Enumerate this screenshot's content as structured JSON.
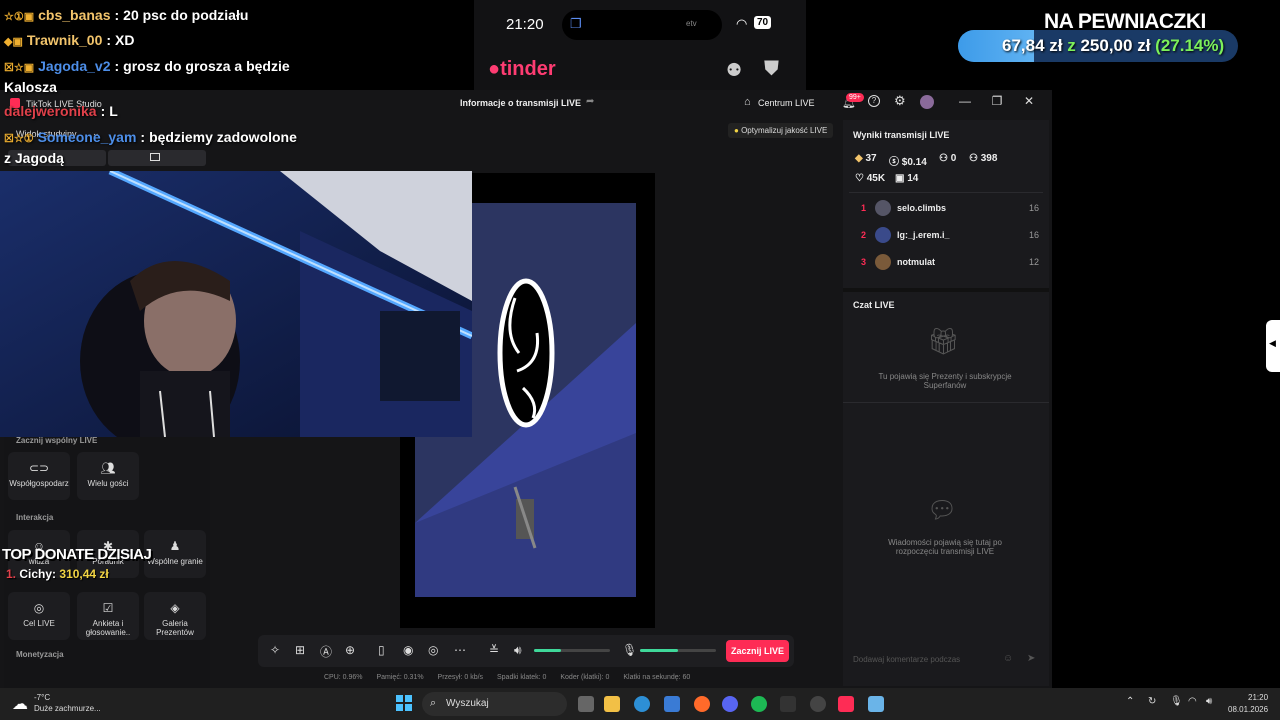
{
  "chat": [
    {
      "badge": "☆①▣",
      "user": "cbs_banas",
      "sep": ":",
      "msg": "20 psc do podziału",
      "color": "orange"
    },
    {
      "badge": "◆▣",
      "user": "Trawnik_00",
      "sep": ":",
      "msg": "XD",
      "color": "orange"
    },
    {
      "badge": "☒☆▣",
      "user": "Jagoda_v2",
      "sep": ":",
      "msg": "grosz do grosza a będzie",
      "color": "blue"
    },
    {
      "badge": "",
      "user": "",
      "sep": "",
      "msg": "Kalosza",
      "color": "white"
    },
    {
      "badge": "",
      "user": "dalejweronika",
      "sep": ":",
      "msg": "L",
      "color": "red"
    },
    {
      "badge": "☒☆①",
      "user": "Someone_yam",
      "sep": ":",
      "msg": "będziemy zadowolone",
      "color": "blue"
    },
    {
      "badge": "",
      "user": "",
      "sep": "",
      "msg": "z Jagodą",
      "color": "white"
    }
  ],
  "phone": {
    "time": "21:20",
    "app": "tinder",
    "battery": "70",
    "tv_label": "etv"
  },
  "goal": {
    "title": "NA PEWNIACZKI",
    "current": "67,84 zł",
    "connector": "z",
    "target": "250,00 zł",
    "percent": "(27.14%)",
    "fraction": 0.2714
  },
  "studio": {
    "app_title": "TikTok LIVE Studio",
    "center_title": "Informacje o transmisji LIVE",
    "centrum": "Centrum LIVE",
    "notif_count": "99+",
    "widok": "Widok studyjny",
    "optimize": "Optymalizuj jakość LIVE"
  },
  "left_panel": {
    "section_shared": "Zacznij wspólny LIVE",
    "cohost": "Współgospodarz",
    "multi": "Wielu gości",
    "section_interaction": "Interakcja",
    "viewers": "widza",
    "guide": "Poradnik",
    "shared_game": "Wspólne granie",
    "goal": "Cel LIVE",
    "poll": "Ankieta i głosowanie..",
    "gallery": "Galeria Prezentów",
    "section_monetization": "Monetyzacja"
  },
  "results": {
    "title": "Wyniki transmisji LIVE",
    "diamonds": "37",
    "money": "$0.14",
    "viewers": "0",
    "followers": "398",
    "likes": "45K",
    "gifts": "14",
    "ranking": [
      {
        "num": "1",
        "name": "selo.climbs",
        "score": "16"
      },
      {
        "num": "2",
        "name": "lg:_j.erem.i_",
        "score": "16"
      },
      {
        "num": "3",
        "name": "notmulat",
        "score": "12"
      }
    ]
  },
  "live_chat": {
    "title": "Czat LIVE",
    "gifts_hint": "Tu pojawią się Prezenty i subskrypcje Superfanów",
    "messages_hint": "Wiadomości pojawią się tutaj po rozpoczęciu transmisji LIVE",
    "comment_placeholder": "Dodawaj komentarze podczas"
  },
  "controls": {
    "start": "Zacznij LIVE",
    "volume_level": 0.35,
    "mic_level": 0.5
  },
  "perf": {
    "cpu": "CPU: 0.96%",
    "memory": "Pamięć: 0.31%",
    "transfer": "Przesył: 0 kb/s",
    "drops": "Spadki klatek: 0",
    "encoder": "Koder (klatki): 0",
    "fps": "Klatki na sekundę: 60"
  },
  "overlay": {
    "top_donate": "TOP DONATE DZISIAJ",
    "donor_rank": "1.",
    "donor": "Cichy:",
    "donor_amount": "310,44 zł"
  },
  "taskbar": {
    "temp": "-7°C",
    "weather": "Duże zachmurze...",
    "search": "Wyszukaj",
    "time": "21:20",
    "date": "08.01.2026"
  }
}
